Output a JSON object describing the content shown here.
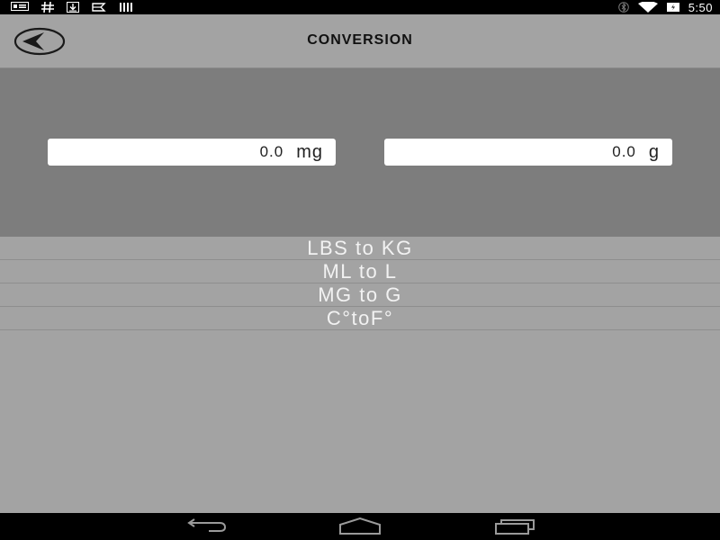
{
  "status_bar": {
    "time": "5:50",
    "left_icons": [
      "notification-icon",
      "hash-icon",
      "download-icon",
      "flag-icon",
      "barcode-icon"
    ],
    "right_icons": [
      "bluetooth-icon",
      "wifi-icon",
      "battery-icon"
    ]
  },
  "action_bar": {
    "title": "CONVERSION",
    "back_icon": "back-arrow-icon"
  },
  "converter": {
    "input": {
      "value": "0.0",
      "unit": "mg"
    },
    "output": {
      "value": "0.0",
      "unit": "g"
    }
  },
  "options": [
    {
      "label": "LBS to KG"
    },
    {
      "label": "ML to L"
    },
    {
      "label": "MG to G"
    },
    {
      "label": "C°toF°"
    }
  ],
  "nav_bar": {
    "buttons": [
      "back-nav-icon",
      "home-nav-icon",
      "recents-nav-icon"
    ]
  },
  "colors": {
    "background": "#a3a3a3",
    "panel": "#7d7d7d",
    "status_bar": "#000000",
    "option_text": "#f2f2f2",
    "title_text": "#111111"
  }
}
